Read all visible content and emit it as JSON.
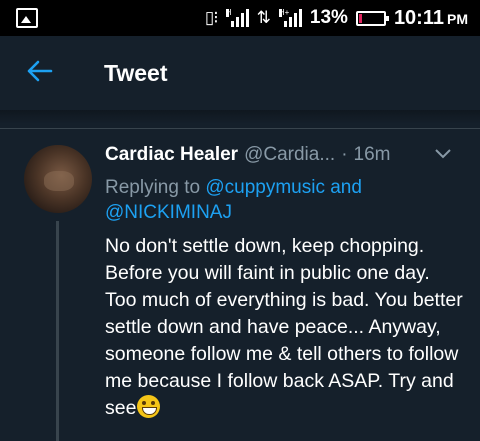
{
  "status_bar": {
    "network_1_label": "H",
    "network_2_label": "H+",
    "battery_percent": "13%",
    "battery_level": 0.13,
    "battery_color": "#e0245e",
    "time": "10:11",
    "ampm": "PM",
    "icons": [
      "gallery-icon",
      "vibrate-icon",
      "signal-icon",
      "data-arrows-icon",
      "signal-icon",
      "battery-icon"
    ]
  },
  "app_bar": {
    "back_icon": "arrow-left-icon",
    "title": "Tweet",
    "accent_color": "#1da1f2"
  },
  "tweet": {
    "author_name": "Cardiac Healer",
    "author_handle": "@Cardia...",
    "separator": "·",
    "time_ago": "16m",
    "menu_icon": "chevron-down-icon",
    "replying_prefix": "Replying to",
    "reply_to_1": "@cuppymusic and",
    "reply_to_2": "@NICKIMINAJ",
    "text": "No don't settle down, keep chopping. Before you will faint in public one day. Too much of everything is bad. You better settle down and have peace... Anyway, someone follow me & tell others to follow me because I follow back ASAP. Try and see",
    "emoji_icon": "grinning-face-emoji"
  }
}
